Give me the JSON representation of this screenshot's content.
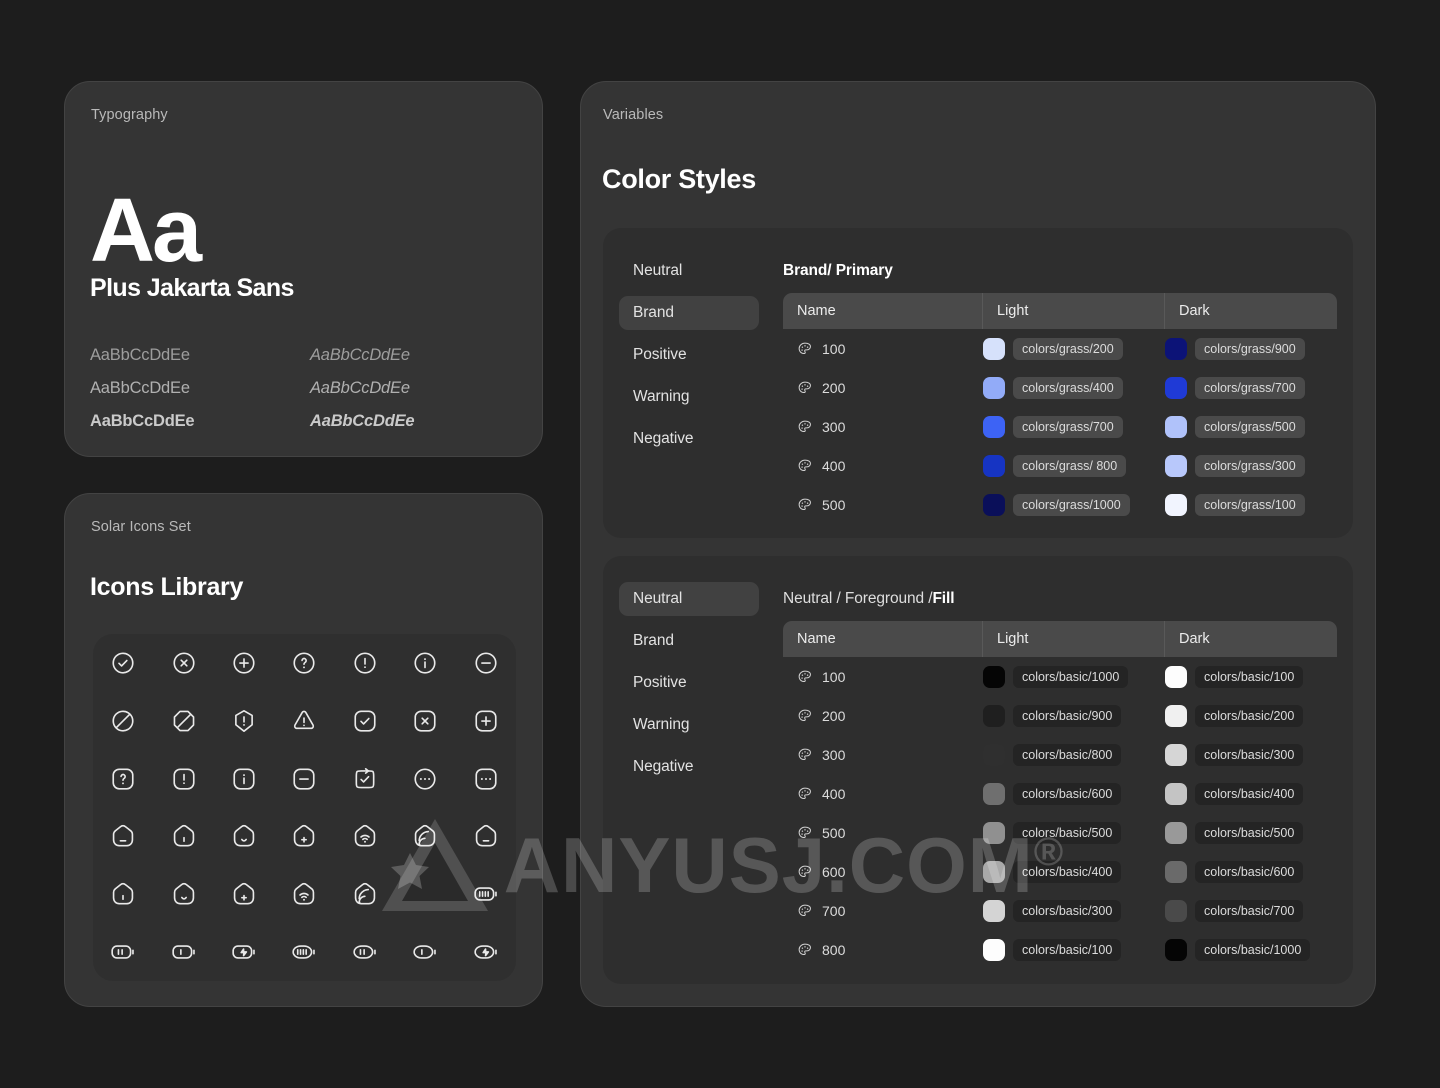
{
  "typography": {
    "eyebrow": "Typography",
    "sample_glyphs": "Aa",
    "family_name": "Plus Jakarta Sans",
    "specimens": [
      {
        "roman": "AaBbCcDdEe",
        "italic": "AaBbCcDdEe"
      },
      {
        "roman": "AaBbCcDdEe",
        "italic": "AaBbCcDdEe"
      },
      {
        "roman": "AaBbCcDdEe",
        "italic": "AaBbCcDdEe"
      }
    ]
  },
  "icons_card": {
    "eyebrow": "Solar Icons Set",
    "title": "Icons Library",
    "grid": [
      "check-circle-icon",
      "x-circle-icon",
      "plus-circle-icon",
      "question-circle-icon",
      "exclamation-circle-icon",
      "info-circle-icon",
      "minus-circle-icon",
      "forbidden-circle-icon",
      "forbidden-octagon-icon",
      "exclamation-hexagon-icon",
      "warning-triangle-icon",
      "check-square-icon",
      "x-square-icon",
      "plus-square-icon",
      "question-square-icon",
      "exclamation-square-icon",
      "info-square-icon",
      "minus-square-icon",
      "clipboard-check-icon",
      "dots-circle-icon",
      "dots-square-icon",
      "home-minus-icon",
      "home-dot-icon",
      "home-smile-icon",
      "home-plus-icon",
      "home-wifi-icon",
      "home-signal-icon",
      "home-angle-icon",
      "home-bold-dot-icon",
      "home-bold-smile-icon",
      "home-bold-plus-icon",
      "home-bold-wifi-icon",
      "home-bold-signal-icon",
      "dots-icon",
      "battery-full-icon",
      "battery-half-icon",
      "battery-low-icon",
      "battery-charge-icon",
      "battery-full-round-icon",
      "battery-half-round-icon",
      "battery-low-round-icon",
      "battery-charge-round-icon"
    ]
  },
  "variables_card": {
    "eyebrow": "Variables",
    "title": "Color Styles"
  },
  "tables": [
    {
      "id": "brand",
      "nav": [
        {
          "label": "Neutral",
          "active": false
        },
        {
          "label": "Brand",
          "active": true
        },
        {
          "label": "Positive",
          "active": false
        },
        {
          "label": "Warning",
          "active": false
        },
        {
          "label": "Negative",
          "active": false
        }
      ],
      "breadcrumb": "Brand/ Primary",
      "breadcrumb_bold": true,
      "chip_style": "light-bg",
      "columns": [
        "Name",
        "Light",
        "Dark"
      ],
      "rows": [
        {
          "name": "100",
          "light_name": "colors/grass/200",
          "light_hex": "#d6e1fb",
          "dark_name": "colors/grass/900",
          "dark_hex": "#0c1377"
        },
        {
          "name": "200",
          "light_name": "colors/grass/400",
          "light_hex": "#92abf8",
          "dark_name": "colors/grass/700",
          "dark_hex": "#1f3ad6"
        },
        {
          "name": "300",
          "light_name": "colors/grass/700",
          "light_hex": "#3d63f5",
          "dark_name": "colors/grass/500",
          "dark_hex": "#b0c2fa"
        },
        {
          "name": "400",
          "light_name": "colors/grass/ 800",
          "light_hex": "#1634c3",
          "dark_name": "colors/grass/300",
          "dark_hex": "#b8c8fb"
        },
        {
          "name": "500",
          "light_name": "colors/grass/1000",
          "light_hex": "#0a0f59",
          "dark_name": "colors/grass/100",
          "dark_hex": "#f1f4fe"
        }
      ]
    },
    {
      "id": "neutral",
      "nav": [
        {
          "label": "Neutral",
          "active": true
        },
        {
          "label": "Brand",
          "active": false
        },
        {
          "label": "Positive",
          "active": false
        },
        {
          "label": "Warning",
          "active": false
        },
        {
          "label": "Negative",
          "active": false
        }
      ],
      "breadcrumb_prefix": "Neutral / Foreground / ",
      "breadcrumb_strong": "Fill",
      "chip_style": "dark-bg",
      "columns": [
        "Name",
        "Light",
        "Dark"
      ],
      "rows": [
        {
          "name": "100",
          "light_name": "colors/basic/1000",
          "light_hex": "#050505",
          "dark_name": "colors/basic/100",
          "dark_hex": "#fdfdfd"
        },
        {
          "name": "200",
          "light_name": "colors/basic/900",
          "light_hex": "#1f1f1f",
          "dark_name": "colors/basic/200",
          "dark_hex": "#f0f0f0"
        },
        {
          "name": "300",
          "light_name": "colors/basic/800",
          "light_hex": "#2f2f2f",
          "dark_name": "colors/basic/300",
          "dark_hex": "#d6d6d6"
        },
        {
          "name": "400",
          "light_name": "colors/basic/600",
          "light_hex": "#6f6f6f",
          "dark_name": "colors/basic/400",
          "dark_hex": "#c4c4c4"
        },
        {
          "name": "500",
          "light_name": "colors/basic/500",
          "light_hex": "#909090",
          "dark_name": "colors/basic/500",
          "dark_hex": "#999999"
        },
        {
          "name": "600",
          "light_name": "colors/basic/400",
          "light_hex": "#a9a9a9",
          "dark_name": "colors/basic/600",
          "dark_hex": "#6a6a6a"
        },
        {
          "name": "700",
          "light_name": "colors/basic/300",
          "light_hex": "#d4d4d4",
          "dark_name": "colors/basic/700",
          "dark_hex": "#4a4a4a"
        },
        {
          "name": "800",
          "light_name": "colors/basic/100",
          "light_hex": "#fdfdfd",
          "dark_name": "colors/basic/1000",
          "dark_hex": "#050505"
        }
      ]
    }
  ],
  "watermark": {
    "text": "ANYUSJ.COM",
    "registered": "®"
  },
  "colors": {
    "page_bg": "#1d1d1d",
    "card_bg": "#343434",
    "panel_bg": "#2e2e2e",
    "table_head_bg": "#4a4a4a",
    "active_nav_bg": "#414141"
  }
}
